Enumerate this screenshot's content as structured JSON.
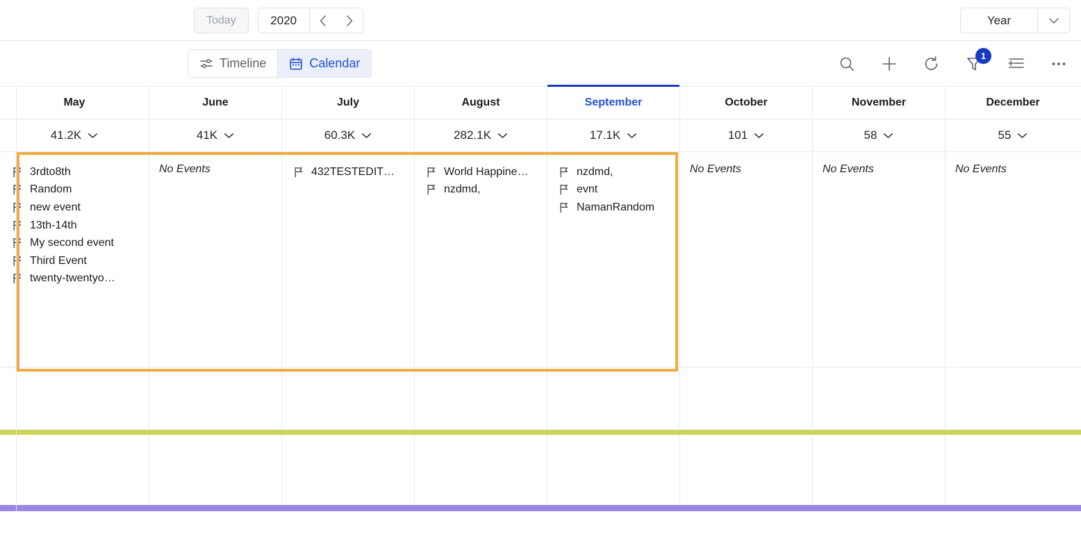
{
  "topbar": {
    "today_label": "Today",
    "year_value": "2020",
    "prev_icon": "chevron-left-icon",
    "next_icon": "chevron-right-icon",
    "period_value": "Year",
    "period_caret_icon": "chevron-down-icon"
  },
  "toolbar": {
    "views": [
      {
        "label": "Timeline",
        "icon": "timeline-icon",
        "active": false
      },
      {
        "label": "Calendar",
        "icon": "calendar-icon",
        "active": true
      }
    ],
    "icons": [
      {
        "name": "search-icon"
      },
      {
        "name": "plus-icon"
      },
      {
        "name": "refresh-icon"
      },
      {
        "name": "filter-icon",
        "badge": "1"
      },
      {
        "name": "row-height-icon"
      },
      {
        "name": "more-options-icon"
      }
    ],
    "filter_badge": "1"
  },
  "colors": {
    "accent_blue": "#2250d4",
    "badge_blue": "#1839c4",
    "selection_orange": "#f0ab44",
    "band_green": "#c9d653",
    "band_purple": "#9a87e2",
    "grid_line": "#e6e8eb"
  },
  "calendar": {
    "no_events_label": "No Events",
    "columns": [
      {
        "month": "May",
        "current": false,
        "summary": "41.2K",
        "events": [
          "3rdto8th",
          "Random",
          "new event",
          "13th-14th",
          "My second event",
          "Third Event",
          "twenty-twentyo…"
        ]
      },
      {
        "month": "June",
        "current": false,
        "summary": "41K",
        "events": []
      },
      {
        "month": "July",
        "current": false,
        "summary": "60.3K",
        "events": [
          "432TESTEDIT…"
        ]
      },
      {
        "month": "August",
        "current": false,
        "summary": "282.1K",
        "events": [
          "World Happine…",
          "nzdmd,"
        ]
      },
      {
        "month": "September",
        "current": true,
        "summary": "17.1K",
        "events": [
          "nzdmd,",
          "evnt",
          "NamanRandom"
        ]
      },
      {
        "month": "October",
        "current": false,
        "summary": "101",
        "events": []
      },
      {
        "month": "November",
        "current": false,
        "summary": "58",
        "events": []
      },
      {
        "month": "December",
        "current": false,
        "summary": "55",
        "events": []
      }
    ]
  }
}
